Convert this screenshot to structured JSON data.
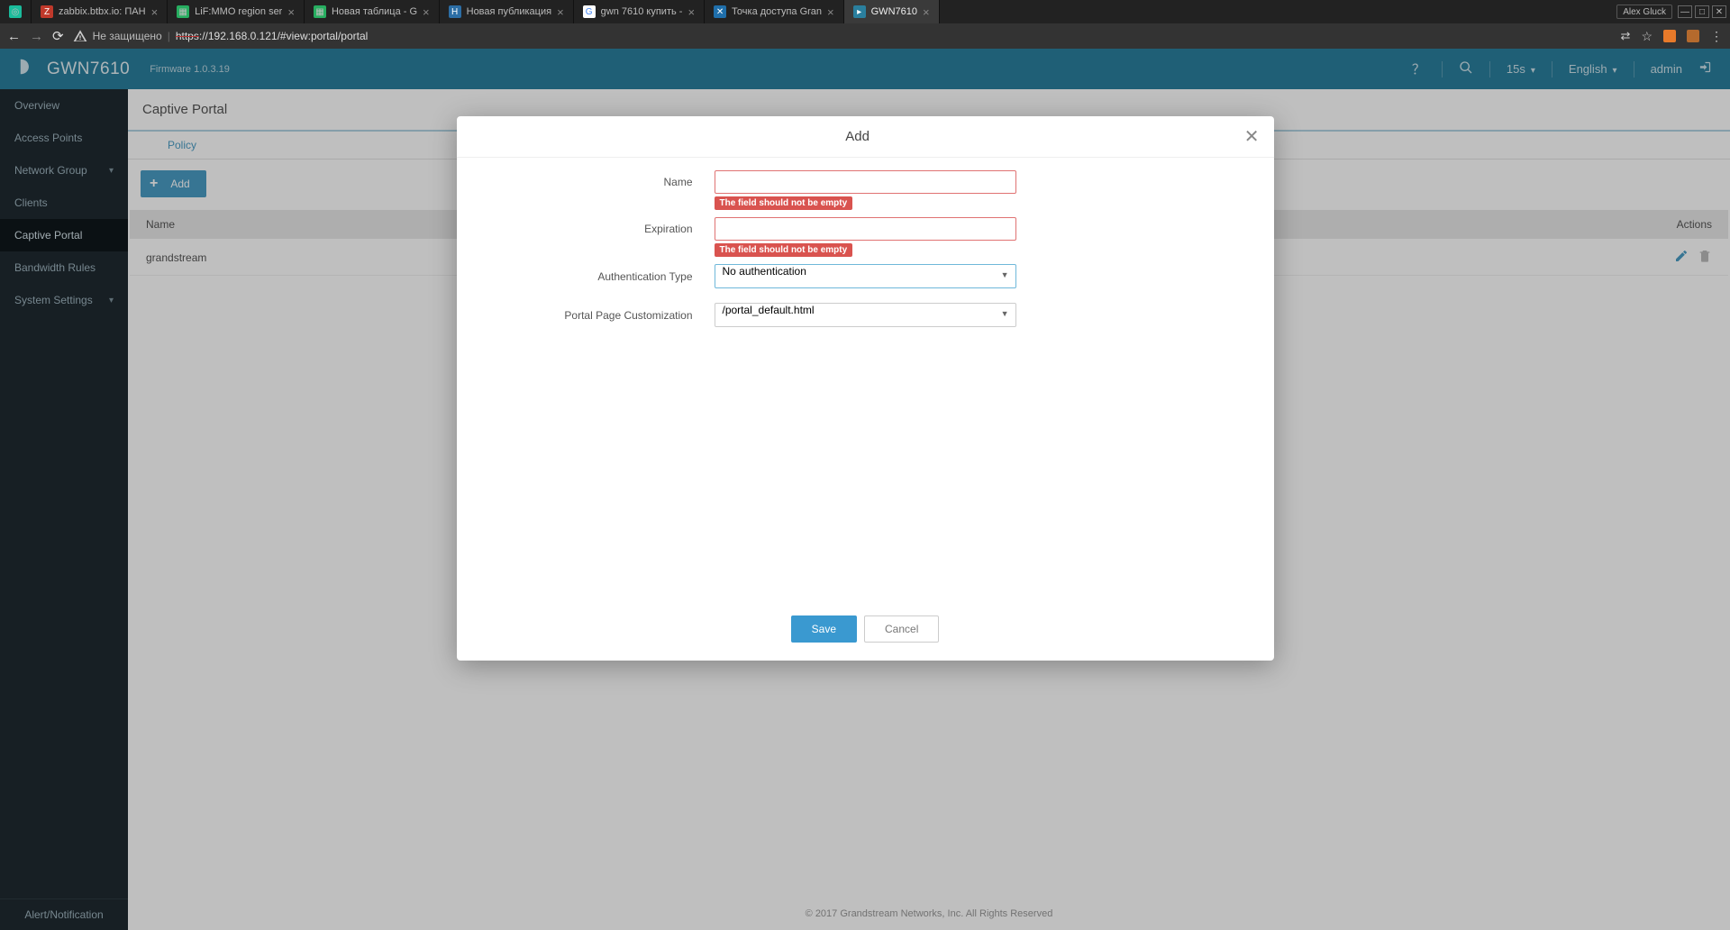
{
  "browser": {
    "user": "Alex Gluck",
    "tabs": [
      {
        "title": "zabbix.btbx.io: ПАН"
      },
      {
        "title": "LiF:MMO region ser"
      },
      {
        "title": "Новая таблица - G"
      },
      {
        "title": "Новая публикация"
      },
      {
        "title": "gwn 7610 купить - "
      },
      {
        "title": "Точка доступа Gran"
      },
      {
        "title": "GWN7610"
      }
    ],
    "insecure_label": "Не защищено",
    "url_proto": "https",
    "url_rest": "://192.168.0.121/#view:portal/portal"
  },
  "header": {
    "product": "GWN7610",
    "firmware": "Firmware 1.0.3.19",
    "refresh": "15s",
    "language": "English",
    "user": "admin"
  },
  "sidebar": {
    "items": [
      {
        "label": "Overview"
      },
      {
        "label": "Access Points"
      },
      {
        "label": "Network Group",
        "chev": true
      },
      {
        "label": "Clients"
      },
      {
        "label": "Captive Portal"
      },
      {
        "label": "Bandwidth Rules"
      },
      {
        "label": "System Settings",
        "chev": true
      }
    ],
    "alert": "Alert/Notification"
  },
  "page": {
    "title": "Captive Portal",
    "tab": "Policy",
    "add_label": "Add",
    "col_name": "Name",
    "col_actions": "Actions",
    "rows": [
      {
        "name": "grandstream"
      }
    ],
    "footer": "© 2017 Grandstream Networks, Inc. All Rights Reserved"
  },
  "modal": {
    "title": "Add",
    "labels": {
      "name": "Name",
      "expiration": "Expiration",
      "auth_type": "Authentication Type",
      "portal_page": "Portal Page Customization"
    },
    "error": "The field should not be empty",
    "auth_value": "No authentication",
    "portal_value": "/portal_default.html",
    "save": "Save",
    "cancel": "Cancel"
  }
}
